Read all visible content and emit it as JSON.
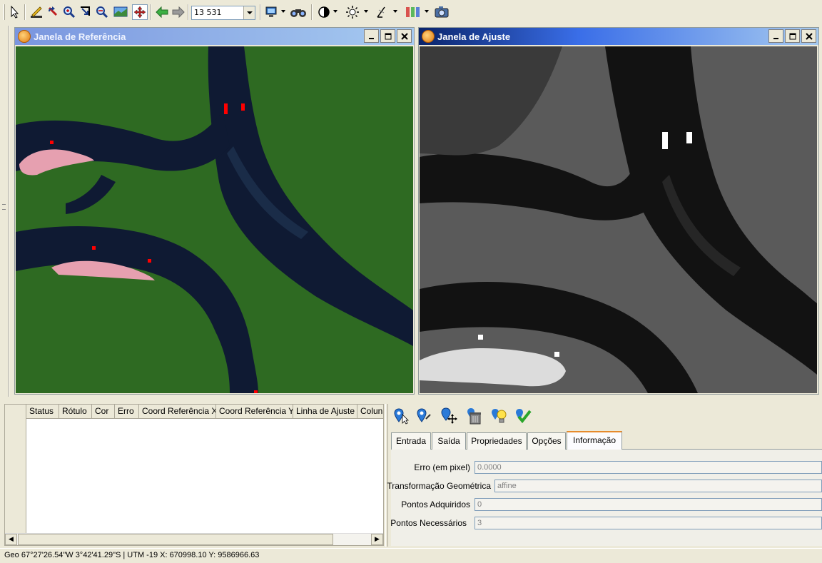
{
  "toolbar": {
    "scale_value": "13 531",
    "buttons": [
      {
        "name": "select-pointer-icon"
      },
      {
        "name": "draw-line-icon"
      },
      {
        "name": "undo-edit-icon"
      },
      {
        "name": "zoom-in-icon"
      },
      {
        "name": "zoom-area-icon"
      },
      {
        "name": "zoom-out-icon"
      },
      {
        "name": "zoom-extent-icon"
      },
      {
        "name": "pan-icon"
      },
      {
        "name": "back-arrow-icon"
      },
      {
        "name": "forward-arrow-icon"
      },
      {
        "name": "display-icon"
      },
      {
        "name": "binoculars-icon"
      },
      {
        "name": "contrast-icon"
      },
      {
        "name": "brightness-icon"
      },
      {
        "name": "measure-icon"
      },
      {
        "name": "bands-icon"
      },
      {
        "name": "camera-icon"
      }
    ]
  },
  "windows": {
    "reference": {
      "title": "Janela de Referência",
      "active": false
    },
    "adjust": {
      "title": "Janela de Ajuste",
      "active": true
    }
  },
  "colors": {
    "river": "#0f1a33",
    "vegetation": "#2e6a22",
    "sandbar": "#e6a0b0",
    "control_point_ref": "#ff0000",
    "control_point_adj": "#ffffff",
    "active_title": "#0a246a",
    "inactive_title": "#7a96df",
    "tab_highlight": "#e68b2c"
  },
  "table": {
    "columns": [
      "Status",
      "Rótulo",
      "Cor",
      "Erro",
      "Coord Referência X",
      "Coord Referência Y",
      "Linha de Ajuste",
      "Coluna"
    ],
    "rows": []
  },
  "adjust_tools": [
    {
      "name": "select-point-icon"
    },
    {
      "name": "add-point-icon"
    },
    {
      "name": "move-point-icon"
    },
    {
      "name": "delete-point-icon"
    },
    {
      "name": "suggest-point-icon"
    },
    {
      "name": "confirm-check-icon"
    }
  ],
  "tabs": [
    "Entrada",
    "Saída",
    "Propriedades",
    "Opções",
    "Informação"
  ],
  "active_tab": "Informação",
  "info": {
    "error_label": "Erro (em pixel)",
    "error_value": "0.0000",
    "transform_label": "Transformação Geométrica",
    "transform_value": "affine",
    "acquired_label": "Pontos Adquiridos",
    "acquired_value": "0",
    "required_label": "Pontos Necessários",
    "required_value": "3"
  },
  "status": {
    "text": "Geo 67°27'26.54\"W 3°42'41.29\"S | UTM -19 X: 670998.10 Y: 9586966.63"
  }
}
